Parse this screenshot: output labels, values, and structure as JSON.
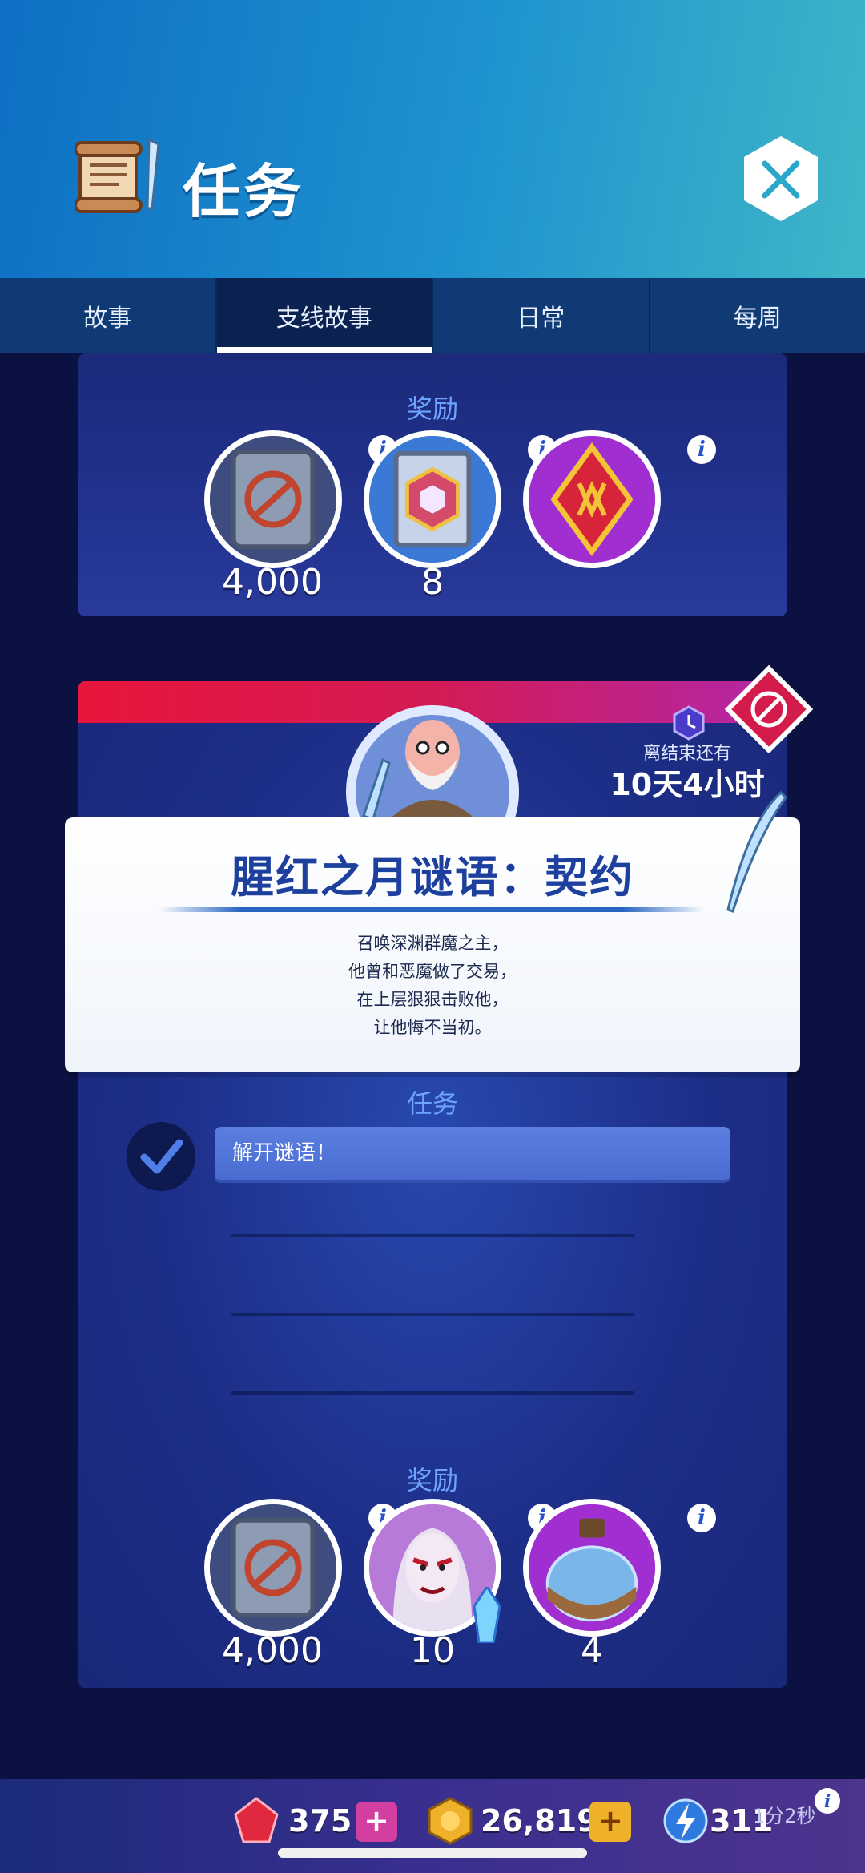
{
  "header": {
    "title": "任务",
    "close_icon": "close-icon"
  },
  "tabs": [
    {
      "label": "故事",
      "active": false
    },
    {
      "label": "支线故事",
      "active": true
    },
    {
      "label": "日常",
      "active": false
    },
    {
      "label": "每周",
      "active": false
    }
  ],
  "top_panel": {
    "rewards_label": "奖励",
    "rewards": [
      {
        "icon": "rune-stone-icon",
        "count": "4,000"
      },
      {
        "icon": "spellbook-icon",
        "count": "8"
      },
      {
        "icon": "red-rune-diamond-icon",
        "count": ""
      }
    ]
  },
  "quest": {
    "expiry_label": "离结束还有",
    "expiry_value": "10天4小时",
    "title": "腥红之月谜语：契约",
    "description": [
      "召唤深渊群魔之主，",
      "他曾和恶魔做了交易，",
      "在上层狠狠击败他，",
      "让他悔不当初。"
    ],
    "tasks_label": "任务",
    "tasks": [
      {
        "label": "解开谜语！",
        "done": true
      }
    ],
    "rewards_label": "奖励",
    "rewards": [
      {
        "icon": "rune-stone-icon",
        "count": "4,000"
      },
      {
        "icon": "vampire-hero-icon",
        "count": "10"
      },
      {
        "icon": "potion-icon",
        "count": "4"
      }
    ]
  },
  "currency": {
    "gems": "375",
    "gold": "26,819",
    "energy": "311",
    "energy_timer": "1分2秒"
  },
  "colors": {
    "header_start": "#0d6fc4",
    "header_end": "#3fb6c8",
    "accent_red": "#e8163c",
    "task_bar": "#5a7fe0"
  }
}
